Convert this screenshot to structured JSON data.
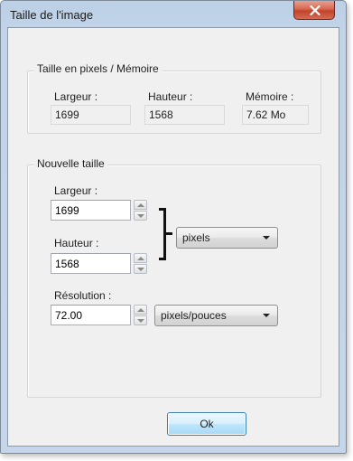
{
  "window": {
    "title": "Taille de l'image"
  },
  "info_group": {
    "legend": "Taille en pixels / Mémoire",
    "width_label": "Largeur :",
    "width_value": "1699",
    "height_label": "Hauteur :",
    "height_value": "1568",
    "memory_label": "Mémoire :",
    "memory_value": "7.62 Mo"
  },
  "resize_group": {
    "legend": "Nouvelle taille",
    "width_label": "Largeur :",
    "width_value": "1699",
    "height_label": "Hauteur :",
    "height_value": "1568",
    "unit_selected": "pixels",
    "resolution_label": "Résolution :",
    "resolution_value": "72.00",
    "resolution_unit_selected": "pixels/pouces"
  },
  "buttons": {
    "ok_label": "Ok"
  },
  "colors": {
    "titlebar": "#c2d4e8",
    "close_button": "#c1442b",
    "dialog_bg": "#f0f0f0",
    "ok_button": "#bee6fd"
  },
  "icons": {
    "close": "close-icon",
    "spin_up": "spin-up-icon",
    "spin_down": "spin-down-icon",
    "dropdown": "chevron-down-icon",
    "link": "link-bracket-icon"
  }
}
